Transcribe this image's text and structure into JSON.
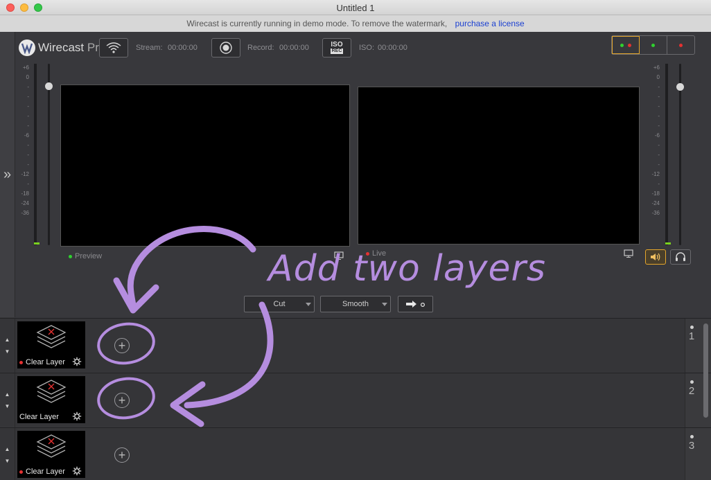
{
  "window": {
    "title": "Untitled 1"
  },
  "banner": {
    "text": "Wirecast is currently running in demo mode. To remove the watermark,",
    "link": "purchase a license"
  },
  "toolbar": {
    "logo_name": "Wirecast",
    "logo_edition": "Pro",
    "stream_label": "Stream:",
    "stream_time": "00:00:00",
    "record_label": "Record:",
    "record_time": "00:00:00",
    "iso_button_top": "ISO",
    "iso_button_bottom": "REC",
    "iso_label": "ISO:",
    "iso_time": "00:00:00"
  },
  "meter_scale": [
    "+6",
    "0",
    "-",
    "-",
    "-",
    "-",
    "-",
    "-6",
    "-",
    "-",
    "-",
    "-12",
    "-",
    "-18",
    "-24",
    "-36"
  ],
  "monitors": {
    "preview_label": "Preview",
    "live_label": "Live"
  },
  "transitions": {
    "first": "Cut",
    "second": "Smooth"
  },
  "layers": [
    {
      "number": "1",
      "title": "Clear Layer",
      "live_dot": true
    },
    {
      "number": "2",
      "title": "Clear Layer",
      "live_dot": false
    },
    {
      "number": "3",
      "title": "Clear Layer",
      "live_dot": true
    }
  ],
  "annotation": {
    "text": "Add two layers"
  },
  "colors": {
    "accent": "#e6a72b",
    "annotation": "#b58ddf",
    "live": "#e53131",
    "preview": "#2fd12f"
  }
}
